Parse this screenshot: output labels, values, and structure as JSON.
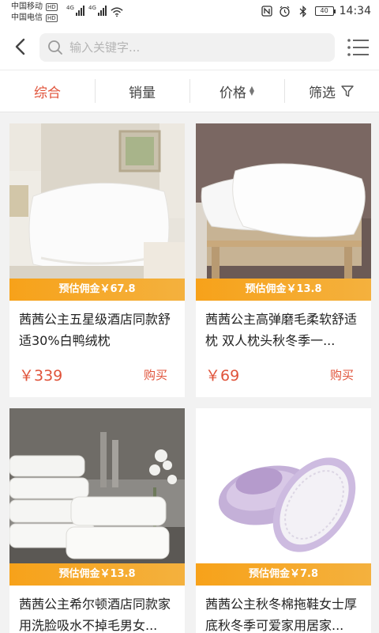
{
  "status_bar": {
    "carrier1": "中国移动",
    "carrier2": "中国电信",
    "hd": "HD",
    "net1": "4G",
    "net2": "4G",
    "battery": "40",
    "time": "14:34"
  },
  "search": {
    "placeholder": "输入关键字..."
  },
  "filters": [
    {
      "label": "综合",
      "active": true
    },
    {
      "label": "销量"
    },
    {
      "label": "价格"
    },
    {
      "label": "筛选"
    }
  ],
  "products": [
    {
      "commission": "预估佣金￥67.8",
      "title": "茜茜公主五星级酒店同款舒适30%白鸭绒枕",
      "price": "￥339",
      "buy": "购买",
      "image": "white-pillow-bedroom"
    },
    {
      "commission": "预估佣金￥13.8",
      "title": "茜茜公主高弹磨毛柔软舒适枕 双人枕头秋冬季一...",
      "price": "￥69",
      "buy": "购买",
      "image": "pillows-on-chair"
    },
    {
      "commission": "预估佣金￥13.8",
      "title": "茜茜公主希尔顿酒店同款家用洗脸吸水不掉毛男女...",
      "price": "",
      "buy": "",
      "image": "white-towels"
    },
    {
      "commission": "预估佣金￥7.8",
      "title": "茜茜公主秋冬棉拖鞋女士厚底秋冬季可爱家用居家...",
      "price": "",
      "buy": "",
      "image": "purple-slippers"
    }
  ],
  "colors": {
    "accent": "#e0533a",
    "commission_bg": "#f7a21a"
  }
}
